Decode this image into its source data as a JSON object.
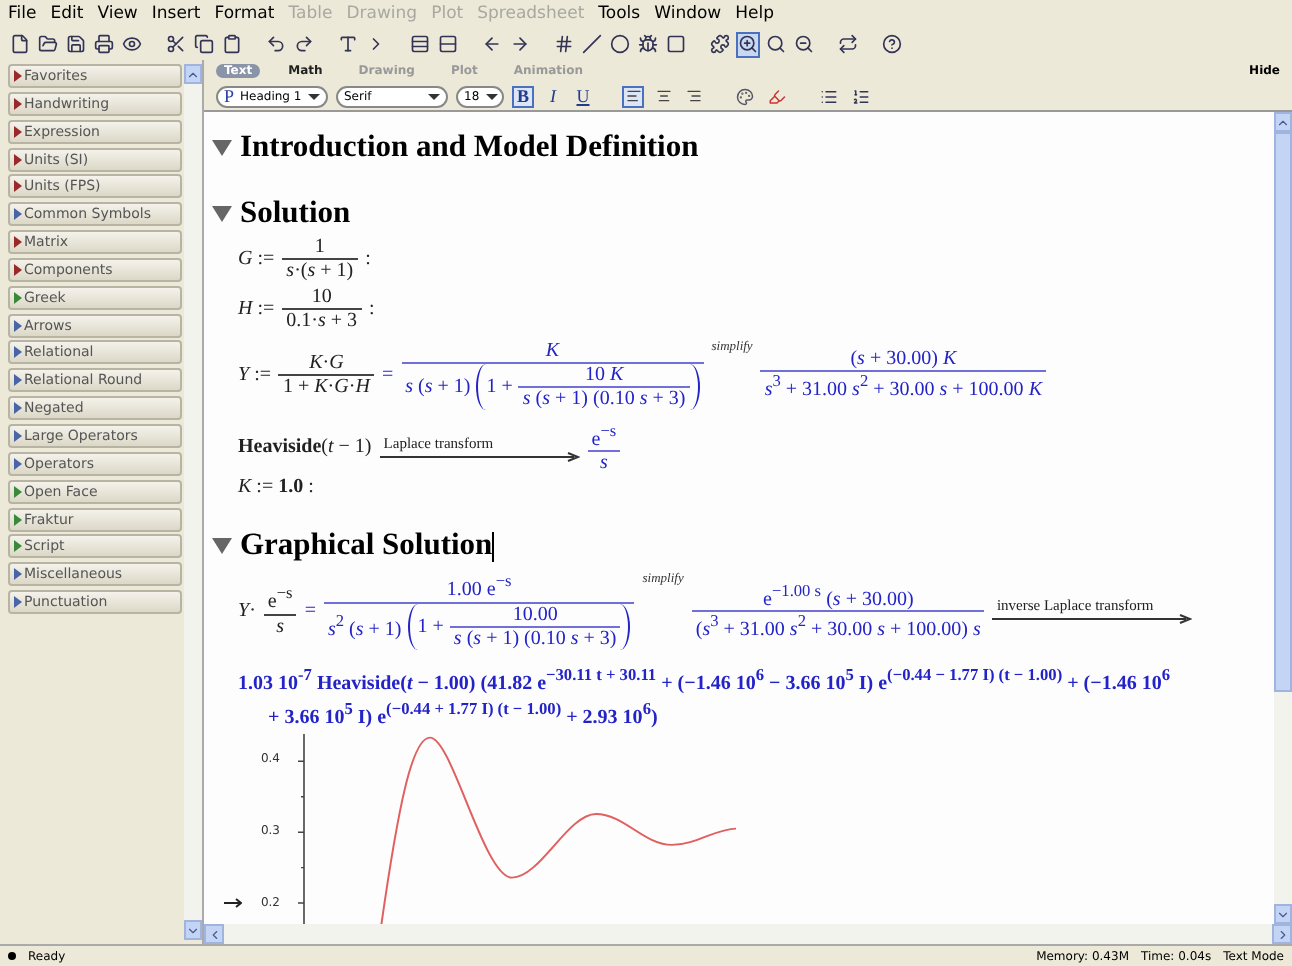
{
  "menu": [
    {
      "label": "File",
      "disabled": false
    },
    {
      "label": "Edit",
      "disabled": false
    },
    {
      "label": "View",
      "disabled": false
    },
    {
      "label": "Insert",
      "disabled": false
    },
    {
      "label": "Format",
      "disabled": false
    },
    {
      "label": "Table",
      "disabled": true
    },
    {
      "label": "Drawing",
      "disabled": true
    },
    {
      "label": "Plot",
      "disabled": true
    },
    {
      "label": "Spreadsheet",
      "disabled": true
    },
    {
      "label": "Tools",
      "disabled": false
    },
    {
      "label": "Window",
      "disabled": false
    },
    {
      "label": "Help",
      "disabled": false
    }
  ],
  "palettes": [
    {
      "label": "Favorites",
      "color": "#9a2a2a"
    },
    {
      "label": "Handwriting",
      "color": "#9a2a2a"
    },
    {
      "label": "Expression",
      "color": "#9a2a2a"
    },
    {
      "label": "Units (SI)",
      "color": "#9a2a2a"
    },
    {
      "label": "Units (FPS)",
      "color": "#9a2a2a"
    },
    {
      "label": "Common Symbols",
      "color": "#4a64a8"
    },
    {
      "label": "Matrix",
      "color": "#9a2a2a"
    },
    {
      "label": "Components",
      "color": "#9a2a2a"
    },
    {
      "label": "Greek",
      "color": "#3a8a3a"
    },
    {
      "label": "Arrows",
      "color": "#4a64a8"
    },
    {
      "label": "Relational",
      "color": "#4a64a8"
    },
    {
      "label": "Relational Round",
      "color": "#4a64a8"
    },
    {
      "label": "Negated",
      "color": "#4a64a8"
    },
    {
      "label": "Large Operators",
      "color": "#4a64a8"
    },
    {
      "label": "Operators",
      "color": "#4a64a8"
    },
    {
      "label": "Open Face",
      "color": "#3a8a3a"
    },
    {
      "label": "Fraktur",
      "color": "#3a8a3a"
    },
    {
      "label": "Script",
      "color": "#3a8a3a"
    },
    {
      "label": "Miscellaneous",
      "color": "#4a64a8"
    },
    {
      "label": "Punctuation",
      "color": "#4a64a8"
    }
  ],
  "context_tabs": [
    {
      "label": "Text",
      "selected": true,
      "disabled": false
    },
    {
      "label": "Math",
      "selected": false,
      "disabled": false
    },
    {
      "label": "Drawing",
      "selected": false,
      "disabled": true
    },
    {
      "label": "Plot",
      "selected": false,
      "disabled": true
    },
    {
      "label": "Animation",
      "selected": false,
      "disabled": true
    }
  ],
  "hide_label": "Hide",
  "format": {
    "paragraph_marker": "P",
    "style": "Heading 1",
    "font": "Serif",
    "size": "18",
    "text_styles": [
      {
        "label": "B",
        "selected": true
      },
      {
        "label": "I",
        "selected": false
      },
      {
        "label": "U",
        "selected": false
      }
    ],
    "alignments": [
      {
        "selected": true
      },
      {
        "selected": false
      },
      {
        "selected": false
      }
    ]
  },
  "document": [
    {
      "kind": "heading",
      "text": "Introduction and Model Definition",
      "expanded": true,
      "cursor": false
    },
    {
      "kind": "heading",
      "text": "Solution",
      "expanded": true,
      "cursor": false
    },
    {
      "kind": "math",
      "nodes": [
        {
          "kind": "text",
          "text": "*G* :=",
          "out": false
        },
        {
          "kind": "frac",
          "out": false,
          "num": [
            {
              "kind": "text",
              "text": "1"
            }
          ],
          "den": [
            {
              "kind": "text",
              "text": "*s*·(*s* + 1)"
            }
          ]
        },
        {
          "kind": "text",
          "text": ":",
          "out": false
        }
      ]
    },
    {
      "kind": "math",
      "nodes": [
        {
          "kind": "text",
          "text": "*H* :=",
          "out": false
        },
        {
          "kind": "frac",
          "out": false,
          "num": [
            {
              "kind": "text",
              "text": "10"
            }
          ],
          "den": [
            {
              "kind": "text",
              "text": "0.1·*s* + 3"
            }
          ]
        },
        {
          "kind": "text",
          "text": ":",
          "out": false
        }
      ]
    },
    {
      "kind": "math",
      "nodes": [
        {
          "kind": "text",
          "text": "*Y* :=",
          "out": false
        },
        {
          "kind": "frac",
          "out": false,
          "num": [
            {
              "kind": "text",
              "text": "*K*·*G*"
            }
          ],
          "den": [
            {
              "kind": "text",
              "text": "1 + *K*·*G*·*H*"
            }
          ]
        },
        {
          "kind": "text",
          "text": "=",
          "out": true
        },
        {
          "kind": "frac",
          "out": true,
          "num": [
            {
              "kind": "text",
              "text": "*K*"
            }
          ],
          "den": [
            {
              "kind": "text",
              "text": "*s* (*s* + 1)"
            },
            {
              "kind": "paren",
              "body": [
                {
                  "kind": "text",
                  "text": "1 +"
                },
                {
                  "kind": "frac",
                  "num": [
                    {
                      "kind": "text",
                      "text": "10 *K*"
                    }
                  ],
                  "den": [
                    {
                      "kind": "text",
                      "text": "*s* (*s* + 1) (0.10 *s* + 3)"
                    }
                  ]
                }
              ]
            }
          ]
        },
        {
          "kind": "op",
          "text": "simplify"
        },
        {
          "kind": "frac",
          "out": true,
          "num": [
            {
              "kind": "text",
              "text": "(*s* + 30.00) *K*"
            }
          ],
          "den": [
            {
              "kind": "text",
              "text": "*s*$^{3}$ + 31.00 *s*$^{2}$ + 30.00 *s* + 100.00 *K*"
            }
          ]
        }
      ]
    },
    {
      "kind": "math",
      "nodes": [
        {
          "kind": "text",
          "text": "**Heaviside**(*t* − 1)",
          "out": false
        },
        {
          "kind": "arrow",
          "text": "Laplace transform"
        },
        {
          "kind": "frac",
          "out": true,
          "num": [
            {
              "kind": "text",
              "text": "e$^{−s}$"
            }
          ],
          "den": [
            {
              "kind": "text",
              "text": "*s*"
            }
          ]
        }
      ]
    },
    {
      "kind": "math",
      "nodes": [
        {
          "kind": "text",
          "text": "*K* := **1.0** :",
          "out": false
        }
      ]
    },
    {
      "kind": "heading",
      "text": "Graphical Solution",
      "expanded": true,
      "cursor": true
    },
    {
      "kind": "math",
      "nodes": [
        {
          "kind": "text",
          "text": "*Y*·",
          "out": false
        },
        {
          "kind": "frac",
          "out": false,
          "num": [
            {
              "kind": "text",
              "text": "e$^{−s}$"
            }
          ],
          "den": [
            {
              "kind": "text",
              "text": "*s*"
            }
          ]
        },
        {
          "kind": "text",
          "text": "=",
          "out": true
        },
        {
          "kind": "frac",
          "out": true,
          "num": [
            {
              "kind": "text",
              "text": "1.00 e$^{−s}$"
            }
          ],
          "den": [
            {
              "kind": "text",
              "text": "*s*$^{2}$ (*s* + 1)"
            },
            {
              "kind": "paren",
              "body": [
                {
                  "kind": "text",
                  "text": "1 +"
                },
                {
                  "kind": "frac",
                  "num": [
                    {
                      "kind": "text",
                      "text": "10.00"
                    }
                  ],
                  "den": [
                    {
                      "kind": "text",
                      "text": "*s* (*s* + 1) (0.10 *s* + 3)"
                    }
                  ]
                }
              ]
            }
          ]
        },
        {
          "kind": "op",
          "text": "simplify"
        },
        {
          "kind": "frac",
          "out": true,
          "num": [
            {
              "kind": "text",
              "text": "e$^{−1.00 s}$ (*s* + 30.00)"
            }
          ],
          "den": [
            {
              "kind": "text",
              "text": "(*s*$^{3}$ + 31.00 *s*$^{2}$ + 30.00 *s* + 100.00) *s*"
            }
          ]
        },
        {
          "kind": "arrow",
          "text": "inverse Laplace transform"
        }
      ]
    },
    {
      "kind": "output",
      "lines": [
        "1.03 10$^{-7}$ Heaviside(*t* − 1.00) (41.82 e$^{−30.11 t + 30.11}$ + (−1.46 10$^{6}$ − 3.66 10$^{5}$ I) e$^{(−0.44 − 1.77 I) (t − 1.00)}$ + (−1.46 10$^{6}$",
        "+ 3.66 10$^{5}$ I) e$^{(−0.44 + 1.77 I) (t − 1.00)}$ + 2.93 10$^{6}$)"
      ]
    },
    {
      "kind": "plot",
      "yticks": [
        "0.4",
        "0.3",
        "0.2"
      ]
    }
  ],
  "status": {
    "state": "Ready",
    "memory": "Memory: 0.43M",
    "time": "Time: 0.04s",
    "mode": "Text Mode"
  }
}
